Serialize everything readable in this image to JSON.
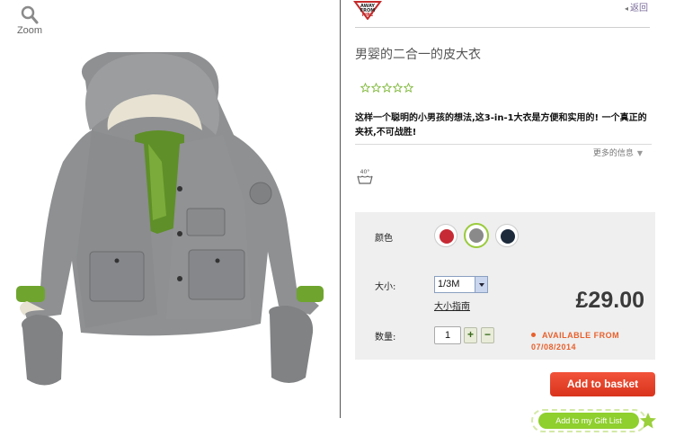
{
  "zoom": {
    "label": "Zoom",
    "icon": "magnifier-icon"
  },
  "brand": {
    "logo_lines": [
      "AWAY",
      "FROM",
      "FIRE"
    ]
  },
  "nav": {
    "back_label": "返回"
  },
  "product": {
    "title": "男婴的二合一的皮大衣",
    "rating_stars": 5,
    "rating_filled": 0,
    "description": "这样一个聪明的小男孩的想法,这3-in-1大衣是方便和实用的! 一个真正的夹袄,不可战胜!",
    "more_info_label": "更多的信息",
    "wash_temp": "40°"
  },
  "options": {
    "color_label": "颜色",
    "colors": [
      {
        "name": "red",
        "hex": "#c62a35",
        "selected": false
      },
      {
        "name": "grey",
        "hex": "#8a8a8a",
        "selected": true
      },
      {
        "name": "navy",
        "hex": "#1c2a3c",
        "selected": false
      }
    ],
    "size_label": "大小:",
    "size_value": "1/3M",
    "size_guide_label": "大小指南",
    "quantity_label": "数量:",
    "quantity_value": "1",
    "plus_label": "+",
    "minus_label": "−",
    "price": "£29.00",
    "availability_line1": "AVAILABLE FROM",
    "availability_line2": "07/08/2014"
  },
  "actions": {
    "add_to_basket": "Add to basket",
    "add_to_gift_list": "Add to my Gift List"
  },
  "colors": {
    "accent_red": "#e2452b",
    "gift_green": "#8fcf2e",
    "availability_orange": "#e8602c"
  }
}
